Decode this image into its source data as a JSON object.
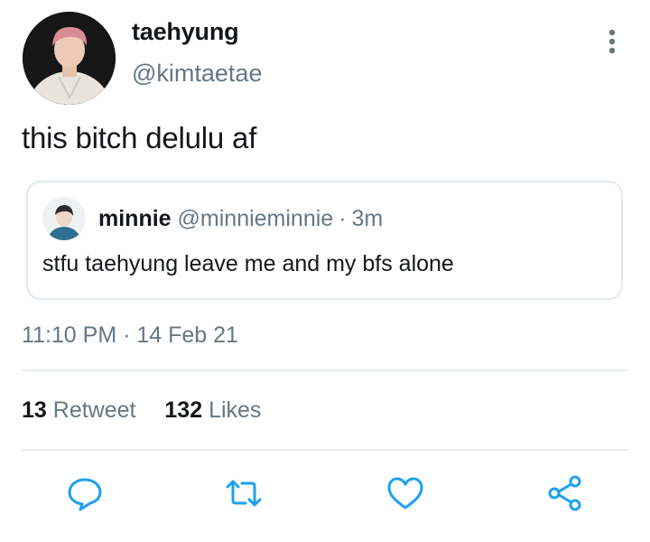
{
  "tweet": {
    "author_name": "taehyung",
    "author_handle": "@kimtaetae",
    "text": "this bitch delulu af",
    "timestamp": "11:10 PM · 14 Feb 21"
  },
  "quote": {
    "author_name": "minnie",
    "author_handle": "@minnieminnie",
    "separator": "·",
    "age": "3m",
    "text": "stfu taehyung leave me and my bfs alone"
  },
  "stats": {
    "retweets_count": "13",
    "retweets_label": "Retweet",
    "likes_count": "132",
    "likes_label": "Likes"
  },
  "icons": {
    "more": "more-vertical-icon",
    "reply": "reply-icon",
    "retweet": "retweet-icon",
    "like": "heart-icon",
    "share": "share-icon"
  },
  "colors": {
    "text": "#14171a",
    "secondary": "#657786",
    "border": "#e1e8ed",
    "icon": "#1da1f2"
  }
}
